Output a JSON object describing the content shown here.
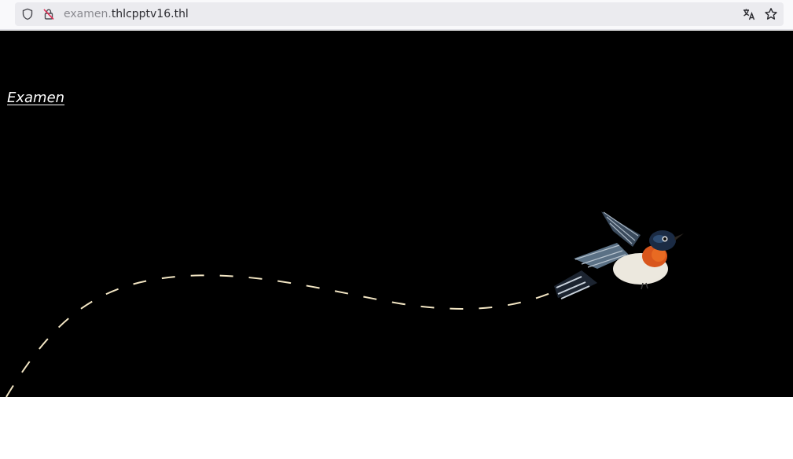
{
  "browser": {
    "url_subdomain": "examen.",
    "url_domain": "thlcpptv16.thl",
    "icons": [
      "shield-icon",
      "insecure-lock-icon",
      "translate-icon",
      "bookmark-star-icon"
    ]
  },
  "page": {
    "title_link": "Examen",
    "background_color": "#000000",
    "path_color": "#f3e6c4"
  }
}
